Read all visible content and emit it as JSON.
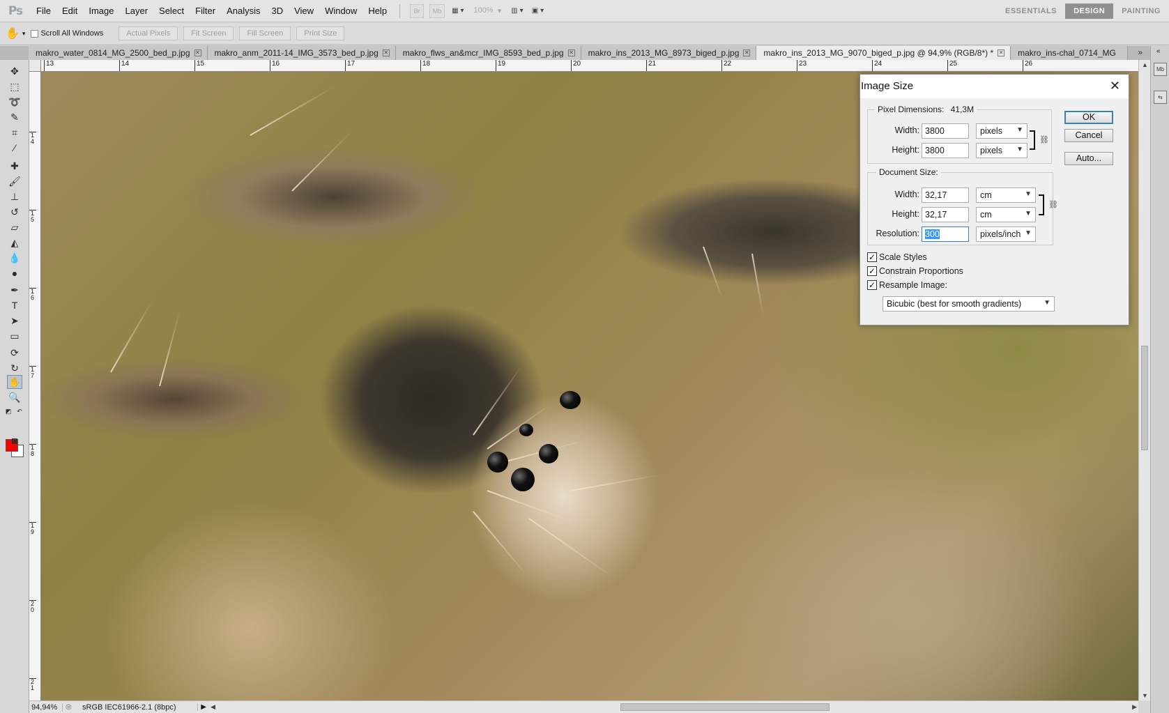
{
  "app": {
    "logo": "Ps",
    "menu": [
      "File",
      "Edit",
      "Image",
      "Layer",
      "Select",
      "Filter",
      "Analysis",
      "3D",
      "View",
      "Window",
      "Help"
    ],
    "bridge_btn": "Br",
    "minibridge_btn": "Mb",
    "zoom_display": "100%",
    "workspaces": [
      "ESSENTIALS",
      "DESIGN",
      "PAINTING"
    ],
    "active_workspace": "DESIGN"
  },
  "options_bar": {
    "scroll_all_windows": "Scroll All Windows",
    "scroll_all_checked": false,
    "buttons": [
      "Actual Pixels",
      "Fit Screen",
      "Fill Screen",
      "Print Size"
    ]
  },
  "tabs": [
    {
      "label": "makro_water_0814_MG_2500_bed_p.jpg",
      "active": false
    },
    {
      "label": "makro_anm_2011-14_IMG_3573_bed_p.jpg",
      "active": false
    },
    {
      "label": "makro_flws_an&mcr_IMG_8593_bed_p.jpg",
      "active": false
    },
    {
      "label": "makro_ins_2013_MG_8973_biged_p.jpg",
      "active": false
    },
    {
      "label": "makro_ins_2013_MG_9070_biged_p.jpg @ 94,9% (RGB/8*) *",
      "active": true
    },
    {
      "label": "makro_ins-chal_0714_MG",
      "active": false
    }
  ],
  "tab_overflow": "»",
  "ruler": {
    "h_labels": [
      "13",
      "14",
      "15",
      "16",
      "17",
      "18",
      "19",
      "20",
      "21",
      "22",
      "23",
      "24",
      "25",
      "26"
    ],
    "v_labels": [
      "14",
      "15",
      "16",
      "17",
      "18",
      "19",
      "20",
      "21"
    ]
  },
  "status": {
    "zoom": "94,94%",
    "profile": "sRGB IEC61966-2.1 (8bpc)"
  },
  "colors": {
    "foreground": "#ff0000",
    "background": "#ffffff",
    "accent": "#3c7fb1"
  },
  "dialog": {
    "title": "Image Size",
    "pixel_dimensions_label": "Pixel Dimensions:",
    "pixel_dimensions_value": "41,3M",
    "px_width_label": "Width:",
    "px_width_value": "3800",
    "px_width_unit": "pixels",
    "px_height_label": "Height:",
    "px_height_value": "3800",
    "px_height_unit": "pixels",
    "document_size_label": "Document Size:",
    "doc_width_label": "Width:",
    "doc_width_value": "32,17",
    "doc_width_unit": "cm",
    "doc_height_label": "Height:",
    "doc_height_value": "32,17",
    "doc_height_unit": "cm",
    "resolution_label": "Resolution:",
    "resolution_value": "300",
    "resolution_unit": "pixels/inch",
    "scale_styles": "Scale Styles",
    "constrain_proportions": "Constrain Proportions",
    "resample_image": "Resample Image:",
    "resample_method": "Bicubic (best for smooth gradients)",
    "ok": "OK",
    "cancel": "Cancel",
    "auto": "Auto..."
  }
}
